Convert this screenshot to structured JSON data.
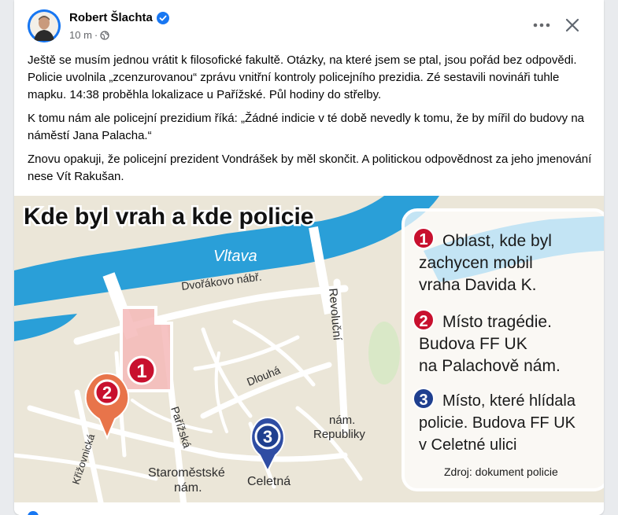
{
  "post": {
    "author": "Robert Šlachta",
    "time": "10 m",
    "separator": "·",
    "paragraphs": [
      "Ještě se musím jednou vrátit k filosofické fakultě. Otázky, na které jsem se ptal, jsou pořád bez odpovědi. Policie uvolnila „zcenzurovanou“ zprávu vnitřní kontroly policejního prezidia. Zé sestavili novináři tuhle mapku. 14:38 proběhla lokalizace u Pařížské. Půl hodiny do střelby.",
      "K tomu nám ale policejní prezidium říká: „Žádné indicie v té době nevedly k tomu, že by mířil do budovy na náměstí Jana Palacha.“",
      "Znovu opakuji, že policejní prezident Vondrášek by měl skončit. A politickou odpovědnost za jeho jmenování nese Vít Rakušan."
    ]
  },
  "map": {
    "title": "Kde byl vrah a kde policie",
    "river": "Vltava",
    "streets": {
      "dvorakovo": "Dvořákovo nábř.",
      "revolucni": "Revoluční",
      "dlouha": "Dlouhá",
      "parizska": "Pařížská",
      "krizovnicka": "Křižovnická",
      "namesti_republiky_1": "nám.",
      "namesti_republiky_2": "Republiky",
      "staromestske_1": "Staroměstské",
      "staromestske_2": "nám.",
      "celetna": "Celetná"
    },
    "markers": [
      "1",
      "2",
      "3"
    ],
    "legend": [
      {
        "number": "1",
        "lines": [
          "Oblast, kde byl",
          "zachycen mobil",
          "vraha Davida K."
        ],
        "color": "#c8102e"
      },
      {
        "number": "2",
        "lines": [
          "Místo tragédie.",
          "Budova FF UK",
          "na Palachově nám."
        ],
        "color": "#c8102e"
      },
      {
        "number": "3",
        "lines": [
          "Místo, které hlídala",
          "policie. Budova FF UK",
          "v Celetné ulici"
        ],
        "color": "#1f3f8f"
      }
    ],
    "source": "Zdroj: dokument policie"
  },
  "icons": {
    "verified": "verified-badge-icon",
    "globe": "globe-icon",
    "more": "more-options-icon",
    "close": "close-icon"
  },
  "colors": {
    "river": "#2a9fd8",
    "land": "#ebe7dc",
    "area": "#f4b8b8",
    "marker_red": "#c8102e",
    "marker_orange": "#e8744a",
    "marker_blue": "#2f4da3",
    "accent": "#1877f2"
  }
}
